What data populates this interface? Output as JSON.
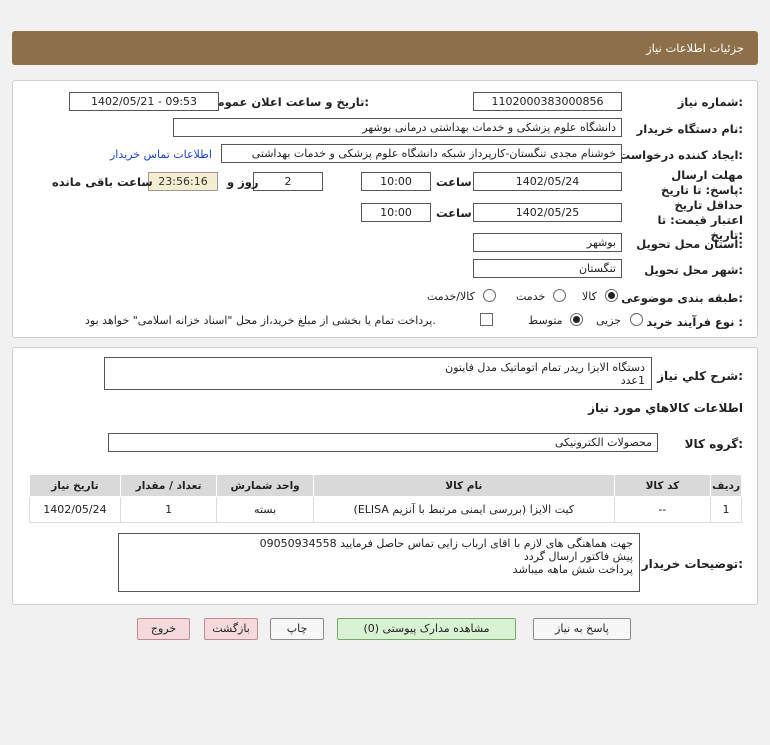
{
  "header": {
    "title": "جزئیات اطلاعات نیاز"
  },
  "form": {
    "need_number_label": "شماره نیاز:",
    "need_number": "1102000383000856",
    "announce_label": "تاریخ و ساعت اعلان عمومی:",
    "announce_value": "1402/05/21 - 09:53",
    "buyer_label": "نام دستگاه خریدار:",
    "buyer_value": "دانشگاه علوم پزشکی و خدمات بهداشتی درمانی بوشهر",
    "requester_label": "ایجاد کننده درخواست:",
    "requester_value": "خوشنام مجدی تنگستان-کارپرداز شبکه دانشگاه علوم پزشکی و خدمات بهداشتی",
    "contact_link": "اطلاعات تماس خریدار",
    "deadline_label": "مهلت ارسال پاسخ: تا تاریخ:",
    "deadline_date": "1402/05/24",
    "hour_label": "ساعت",
    "deadline_time": "10:00",
    "days_value": "2",
    "days_label": "روز و",
    "remaining_time": "23:56:16",
    "remaining_label": "ساعت باقی مانده",
    "validity_label": "حداقل تاریخ اعتبار قیمت: تا تاریخ:",
    "validity_date": "1402/05/25",
    "validity_time": "10:00",
    "province_label": "استان محل تحویل:",
    "province_value": "بوشهر",
    "city_label": "شهر محل تحویل:",
    "city_value": "تنگستان",
    "category_label": "طبقه بندی موضوعی:",
    "category_options": [
      "کالا",
      "خدمت",
      "کالا/خدمت"
    ],
    "category_selected": "کالا",
    "process_label": "نوع فرآیند خرید :",
    "process_options": [
      "جزیی",
      "متوسط"
    ],
    "process_selected": "متوسط",
    "payment_note": "پرداخت تمام یا بخشی از مبلغ خرید،از محل \"اسناد خزانه اسلامی\" خواهد بود."
  },
  "summary": {
    "label": "شرح کلي نياز:",
    "line1": "دستگاه الایزا ریدر تمام اتوماتیک مدل فایتون",
    "line2": "1عدد"
  },
  "goods": {
    "section_title": "اطلاعات کالاهاي مورد نياز",
    "group_label": "گروه کالا:",
    "group_value": "محصولات الکترونیکی",
    "columns": [
      "ردیف",
      "کد کالا",
      "نام کالا",
      "واحد شمارش",
      "تعداد / مقدار",
      "تاریخ نیاز"
    ],
    "rows": [
      [
        "1",
        "--",
        "کیت الایزا (بررسی ایمنی مرتبط با آنزیم ELISA)",
        "بسته",
        "1",
        "1402/05/24"
      ]
    ]
  },
  "notes": {
    "label": "توضیحات خریدار:",
    "line1": "جهت هماهنگی های لازم با اقای ارباب زایی تماس حاصل فرمایید 09050934558",
    "line2": "پیش فاکتور ارسال گردد",
    "line3": "پرداخت شش ماهه میباشد"
  },
  "buttons": {
    "reply": "پاسخ به نیاز",
    "attachments": "مشاهده مدارک پیوستی (0)",
    "print": "چاپ",
    "back": "بازگشت",
    "exit": "خروج"
  }
}
